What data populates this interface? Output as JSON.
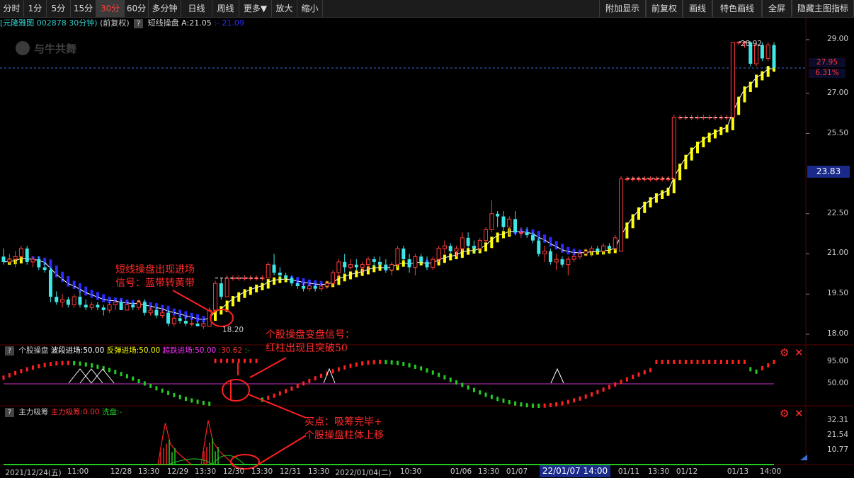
{
  "toolbar": {
    "left": [
      "分时",
      "1分",
      "5分",
      "15分",
      "30分",
      "60分",
      "多分钟",
      "日线",
      "周线",
      "更多▼",
      "放大",
      "缩小"
    ],
    "active": "30分",
    "right": [
      "附加显示",
      "前复权",
      "画线",
      "特色画线",
      "全屏",
      "隐藏主图指标"
    ]
  },
  "info": {
    "stock": "[元隆雅图",
    "code": "002878 30分钟)",
    "adj": "(前复权)",
    "indicator": "短线操盘",
    "a_value": "A:21.05",
    "extra": ":- 21.09"
  },
  "watermark": "与牛共舞",
  "main_panel": {
    "y_ticks": [
      "29.00",
      "27.00",
      "25.50",
      "22.50",
      "21.00",
      "19.50",
      "18.00"
    ],
    "price_line": "27.95",
    "pct_line": "6.31%",
    "cursor_price": "23.83",
    "high_label": "28.92",
    "low_label": "18.20"
  },
  "mid_panel": {
    "title": "个股操盘",
    "legend1": "波段进场:50.00",
    "legend2": "反弹进场:50.00",
    "legend3": "超跌进场:50.00",
    "legend4": ":30.62",
    "legend5": ":-",
    "y_ticks": [
      "95.00",
      "50.00"
    ]
  },
  "bot_panel": {
    "title": "主力吸筹",
    "legend1": "主力吸筹:0.00",
    "legend2": "洗盘:-",
    "y_ticks": [
      "32.31",
      "21.54",
      "10.77"
    ]
  },
  "x_axis": {
    "labels": [
      "2021/12/24(五)",
      "11:00",
      "12/28",
      "13:30",
      "12/29",
      "13:30",
      "12/30",
      "13:30",
      "12/31",
      "13:30",
      "2022/01/04(二)",
      "10:30",
      "01/06",
      "13:30",
      "01/07",
      "01/11",
      "13:30",
      "01/12",
      "01/13",
      "14:00"
    ],
    "cursor": "22/01/07 14:00"
  },
  "annotations": {
    "a1_line1": "短线操盘出现进场",
    "a1_line2": "信号：蓝带转黄带",
    "a2_line1": "个股操盘变盘信号：",
    "a2_line2": "红柱出现且突破50",
    "a3_line1": "买点：吸筹完毕+",
    "a3_line2": "个股操盘柱体上移"
  },
  "colors": {
    "up": "#ff3b3b",
    "down": "#3ee6e6",
    "trend_up": "#ffff00",
    "trend_down": "#2b2bff",
    "signal_red": "#ff0000",
    "signal_green": "#22cc22",
    "mid_line": "#cc33cc"
  },
  "chart_data": {
    "type": "candlestick",
    "bars": [
      {
        "o": 20.9,
        "h": 21.2,
        "l": 20.6,
        "c": 20.7
      },
      {
        "o": 20.7,
        "h": 21.0,
        "l": 20.6,
        "c": 20.8
      },
      {
        "o": 20.8,
        "h": 21.1,
        "l": 20.5,
        "c": 20.9
      },
      {
        "o": 20.9,
        "h": 21.3,
        "l": 20.8,
        "c": 21.2
      },
      {
        "o": 21.2,
        "h": 21.3,
        "l": 20.6,
        "c": 20.7
      },
      {
        "o": 20.7,
        "h": 20.9,
        "l": 20.5,
        "c": 20.8
      },
      {
        "o": 20.8,
        "h": 20.9,
        "l": 20.4,
        "c": 20.5
      },
      {
        "o": 20.5,
        "h": 20.7,
        "l": 20.3,
        "c": 20.4
      },
      {
        "o": 20.4,
        "h": 20.5,
        "l": 19.2,
        "c": 19.4
      },
      {
        "o": 19.4,
        "h": 19.6,
        "l": 19.1,
        "c": 19.2
      },
      {
        "o": 19.2,
        "h": 19.5,
        "l": 19.0,
        "c": 19.3
      },
      {
        "o": 19.3,
        "h": 19.4,
        "l": 19.0,
        "c": 19.1
      },
      {
        "o": 19.1,
        "h": 19.5,
        "l": 19.0,
        "c": 19.4
      },
      {
        "o": 19.4,
        "h": 19.6,
        "l": 19.0,
        "c": 19.1
      },
      {
        "o": 19.1,
        "h": 19.3,
        "l": 18.9,
        "c": 19.0
      },
      {
        "o": 19.0,
        "h": 19.2,
        "l": 18.9,
        "c": 19.1
      },
      {
        "o": 19.1,
        "h": 19.2,
        "l": 18.9,
        "c": 19.0
      },
      {
        "o": 19.0,
        "h": 19.1,
        "l": 18.7,
        "c": 18.9
      },
      {
        "o": 18.9,
        "h": 19.2,
        "l": 18.8,
        "c": 19.1
      },
      {
        "o": 19.1,
        "h": 19.3,
        "l": 18.9,
        "c": 19.2
      },
      {
        "o": 19.2,
        "h": 19.3,
        "l": 18.9,
        "c": 18.9
      },
      {
        "o": 18.9,
        "h": 19.2,
        "l": 18.9,
        "c": 19.1
      },
      {
        "o": 19.1,
        "h": 19.2,
        "l": 18.9,
        "c": 19.0
      },
      {
        "o": 19.0,
        "h": 19.3,
        "l": 18.9,
        "c": 19.2
      },
      {
        "o": 19.2,
        "h": 19.3,
        "l": 18.7,
        "c": 18.8
      },
      {
        "o": 18.8,
        "h": 19.0,
        "l": 18.7,
        "c": 18.9
      },
      {
        "o": 18.9,
        "h": 19.0,
        "l": 18.6,
        "c": 18.7
      },
      {
        "o": 18.7,
        "h": 18.9,
        "l": 18.6,
        "c": 18.8
      },
      {
        "o": 18.8,
        "h": 18.9,
        "l": 18.3,
        "c": 18.4
      },
      {
        "o": 18.4,
        "h": 18.7,
        "l": 18.3,
        "c": 18.6
      },
      {
        "o": 18.6,
        "h": 18.7,
        "l": 18.4,
        "c": 18.5
      },
      {
        "o": 18.5,
        "h": 18.7,
        "l": 18.3,
        "c": 18.4
      },
      {
        "o": 18.4,
        "h": 18.6,
        "l": 18.3,
        "c": 18.4
      },
      {
        "o": 18.4,
        "h": 18.5,
        "l": 18.3,
        "c": 18.3
      },
      {
        "o": 18.3,
        "h": 18.5,
        "l": 18.2,
        "c": 18.4
      },
      {
        "o": 18.3,
        "h": 19.0,
        "l": 18.3,
        "c": 18.9
      },
      {
        "o": 18.9,
        "h": 20.0,
        "l": 18.8,
        "c": 19.9
      },
      {
        "o": 19.9,
        "h": 20.1,
        "l": 19.3,
        "c": 19.4
      },
      {
        "o": 19.4,
        "h": 20.2,
        "l": 19.4,
        "c": 20.1
      },
      {
        "o": 20.1,
        "h": 20.2,
        "l": 20.0,
        "c": 20.1
      },
      {
        "o": 20.1,
        "h": 20.2,
        "l": 20.0,
        "c": 20.1
      },
      {
        "o": 20.1,
        "h": 20.2,
        "l": 20.0,
        "c": 20.1
      },
      {
        "o": 20.1,
        "h": 20.2,
        "l": 20.0,
        "c": 20.1
      },
      {
        "o": 20.1,
        "h": 20.2,
        "l": 20.0,
        "c": 20.1
      },
      {
        "o": 20.1,
        "h": 20.2,
        "l": 20.0,
        "c": 20.1
      },
      {
        "o": 20.1,
        "h": 20.7,
        "l": 20.1,
        "c": 20.6
      },
      {
        "o": 20.6,
        "h": 21.0,
        "l": 20.2,
        "c": 20.3
      },
      {
        "o": 20.3,
        "h": 20.5,
        "l": 20.0,
        "c": 20.2
      },
      {
        "o": 20.2,
        "h": 20.3,
        "l": 20.0,
        "c": 20.1
      },
      {
        "o": 20.1,
        "h": 20.2,
        "l": 19.8,
        "c": 19.9
      },
      {
        "o": 19.9,
        "h": 20.0,
        "l": 19.7,
        "c": 19.8
      },
      {
        "o": 19.8,
        "h": 19.9,
        "l": 19.6,
        "c": 19.7
      },
      {
        "o": 19.7,
        "h": 19.9,
        "l": 19.6,
        "c": 19.8
      },
      {
        "o": 19.8,
        "h": 19.9,
        "l": 19.6,
        "c": 19.7
      },
      {
        "o": 19.7,
        "h": 19.9,
        "l": 19.6,
        "c": 19.8
      },
      {
        "o": 19.8,
        "h": 20.0,
        "l": 19.7,
        "c": 19.9
      },
      {
        "o": 19.9,
        "h": 20.4,
        "l": 19.8,
        "c": 20.3
      },
      {
        "o": 20.3,
        "h": 20.8,
        "l": 20.1,
        "c": 20.7
      },
      {
        "o": 20.7,
        "h": 21.0,
        "l": 20.3,
        "c": 20.5
      },
      {
        "o": 20.5,
        "h": 20.8,
        "l": 20.4,
        "c": 20.6
      },
      {
        "o": 20.6,
        "h": 20.8,
        "l": 20.4,
        "c": 20.5
      },
      {
        "o": 20.5,
        "h": 20.7,
        "l": 20.3,
        "c": 20.6
      },
      {
        "o": 20.6,
        "h": 20.9,
        "l": 20.4,
        "c": 20.8
      },
      {
        "o": 20.8,
        "h": 20.9,
        "l": 20.5,
        "c": 20.7
      },
      {
        "o": 20.7,
        "h": 20.9,
        "l": 20.5,
        "c": 20.6
      },
      {
        "o": 20.6,
        "h": 20.8,
        "l": 20.3,
        "c": 20.4
      },
      {
        "o": 20.4,
        "h": 20.7,
        "l": 20.2,
        "c": 20.6
      },
      {
        "o": 20.6,
        "h": 21.3,
        "l": 20.5,
        "c": 21.2
      },
      {
        "o": 21.2,
        "h": 21.3,
        "l": 20.7,
        "c": 20.8
      },
      {
        "o": 20.8,
        "h": 21.0,
        "l": 20.3,
        "c": 20.5
      },
      {
        "o": 20.5,
        "h": 21.0,
        "l": 20.2,
        "c": 20.9
      },
      {
        "o": 20.9,
        "h": 21.0,
        "l": 20.6,
        "c": 20.7
      },
      {
        "o": 20.7,
        "h": 20.9,
        "l": 20.4,
        "c": 20.5
      },
      {
        "o": 20.5,
        "h": 20.9,
        "l": 20.4,
        "c": 20.8
      },
      {
        "o": 20.8,
        "h": 21.3,
        "l": 20.7,
        "c": 21.2
      },
      {
        "o": 21.2,
        "h": 21.5,
        "l": 21.0,
        "c": 21.3
      },
      {
        "o": 21.3,
        "h": 21.4,
        "l": 21.0,
        "c": 21.1
      },
      {
        "o": 21.1,
        "h": 21.3,
        "l": 20.9,
        "c": 21.2
      },
      {
        "o": 21.2,
        "h": 21.8,
        "l": 21.1,
        "c": 21.6
      },
      {
        "o": 21.6,
        "h": 21.8,
        "l": 21.2,
        "c": 21.3
      },
      {
        "o": 21.3,
        "h": 21.5,
        "l": 21.0,
        "c": 21.2
      },
      {
        "o": 21.2,
        "h": 21.6,
        "l": 21.1,
        "c": 21.5
      },
      {
        "o": 21.5,
        "h": 22.0,
        "l": 21.4,
        "c": 21.9
      },
      {
        "o": 21.9,
        "h": 23.0,
        "l": 21.8,
        "c": 22.5
      },
      {
        "o": 22.5,
        "h": 22.6,
        "l": 22.0,
        "c": 22.4
      },
      {
        "o": 22.4,
        "h": 22.6,
        "l": 21.8,
        "c": 22.0
      },
      {
        "o": 22.0,
        "h": 22.4,
        "l": 21.7,
        "c": 22.3
      },
      {
        "o": 22.3,
        "h": 22.6,
        "l": 21.7,
        "c": 21.8
      },
      {
        "o": 21.8,
        "h": 22.0,
        "l": 21.6,
        "c": 21.8
      },
      {
        "o": 21.8,
        "h": 22.0,
        "l": 21.6,
        "c": 21.7
      },
      {
        "o": 21.7,
        "h": 21.8,
        "l": 21.4,
        "c": 21.5
      },
      {
        "o": 21.5,
        "h": 21.6,
        "l": 20.9,
        "c": 21.0
      },
      {
        "o": 21.0,
        "h": 21.3,
        "l": 20.7,
        "c": 21.1
      },
      {
        "o": 21.1,
        "h": 21.2,
        "l": 20.6,
        "c": 20.7
      },
      {
        "o": 20.7,
        "h": 21.0,
        "l": 20.4,
        "c": 20.8
      },
      {
        "o": 20.8,
        "h": 20.9,
        "l": 20.5,
        "c": 20.6
      },
      {
        "o": 20.6,
        "h": 20.9,
        "l": 20.2,
        "c": 20.8
      },
      {
        "o": 20.8,
        "h": 21.0,
        "l": 20.7,
        "c": 20.9
      },
      {
        "o": 20.9,
        "h": 21.1,
        "l": 20.8,
        "c": 21.0
      },
      {
        "o": 21.0,
        "h": 21.2,
        "l": 20.9,
        "c": 21.1
      },
      {
        "o": 21.1,
        "h": 21.3,
        "l": 20.9,
        "c": 21.2
      },
      {
        "o": 21.2,
        "h": 21.3,
        "l": 21.0,
        "c": 21.1
      },
      {
        "o": 21.1,
        "h": 21.4,
        "l": 21.0,
        "c": 21.3
      },
      {
        "o": 21.3,
        "h": 21.4,
        "l": 21.0,
        "c": 21.2
      },
      {
        "o": 21.2,
        "h": 21.7,
        "l": 21.1,
        "c": 21.6
      },
      {
        "o": 21.1,
        "h": 23.9,
        "l": 21.1,
        "c": 23.8
      },
      {
        "o": 23.8,
        "h": 23.9,
        "l": 23.7,
        "c": 23.8
      },
      {
        "o": 23.8,
        "h": 23.9,
        "l": 23.7,
        "c": 23.8
      },
      {
        "o": 23.8,
        "h": 23.9,
        "l": 23.7,
        "c": 23.8
      },
      {
        "o": 23.8,
        "h": 23.9,
        "l": 23.7,
        "c": 23.8
      },
      {
        "o": 23.8,
        "h": 23.9,
        "l": 23.7,
        "c": 23.8
      },
      {
        "o": 23.8,
        "h": 23.9,
        "l": 23.7,
        "c": 23.8
      },
      {
        "o": 23.8,
        "h": 23.9,
        "l": 23.7,
        "c": 23.8
      },
      {
        "o": 23.8,
        "h": 23.9,
        "l": 23.7,
        "c": 23.8
      },
      {
        "o": 23.8,
        "h": 26.2,
        "l": 23.8,
        "c": 26.1
      },
      {
        "o": 26.1,
        "h": 26.2,
        "l": 26.0,
        "c": 26.1
      },
      {
        "o": 26.1,
        "h": 26.2,
        "l": 26.0,
        "c": 26.1
      },
      {
        "o": 26.1,
        "h": 26.2,
        "l": 26.0,
        "c": 26.1
      },
      {
        "o": 26.1,
        "h": 26.2,
        "l": 26.0,
        "c": 26.1
      },
      {
        "o": 26.1,
        "h": 26.2,
        "l": 26.0,
        "c": 26.1
      },
      {
        "o": 26.1,
        "h": 26.2,
        "l": 26.0,
        "c": 26.1
      },
      {
        "o": 26.1,
        "h": 26.2,
        "l": 26.0,
        "c": 26.1
      },
      {
        "o": 26.1,
        "h": 26.2,
        "l": 26.0,
        "c": 26.1
      },
      {
        "o": 26.1,
        "h": 26.2,
        "l": 26.0,
        "c": 26.1
      },
      {
        "o": 26.1,
        "h": 28.9,
        "l": 27.7,
        "c": 28.9
      },
      {
        "o": 28.9,
        "h": 28.9,
        "l": 28.8,
        "c": 28.9
      },
      {
        "o": 28.9,
        "h": 28.92,
        "l": 28.7,
        "c": 28.9
      },
      {
        "o": 28.9,
        "h": 28.92,
        "l": 28.0,
        "c": 28.1
      },
      {
        "o": 28.1,
        "h": 28.9,
        "l": 28.0,
        "c": 28.8
      },
      {
        "o": 28.8,
        "h": 28.9,
        "l": 28.2,
        "c": 28.3
      },
      {
        "o": 28.3,
        "h": 28.9,
        "l": 28.2,
        "c": 28.8
      },
      {
        "o": 28.8,
        "h": 28.9,
        "l": 27.9,
        "c": 27.95
      }
    ]
  }
}
